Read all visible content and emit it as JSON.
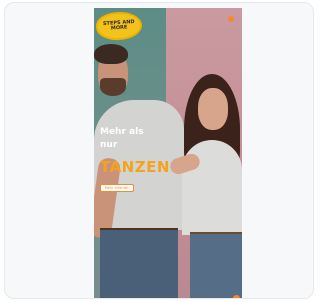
{
  "logo": {
    "text": "STEPS AND MORE"
  },
  "hero": {
    "headline_line1": "Mehr als",
    "headline_line2": "nur",
    "highlight": "TANZEN",
    "cta_label": "Mehr erfahren"
  },
  "colors": {
    "accent": "#f5892d",
    "highlight": "#f5a21f",
    "logo_yellow": "#f3c21b",
    "bg_teal": "#5d8c86",
    "bg_pink": "#c99aa0"
  },
  "icons": {
    "menu": "menu-dot-icon",
    "scroll": "scroll-indicator-icon"
  }
}
